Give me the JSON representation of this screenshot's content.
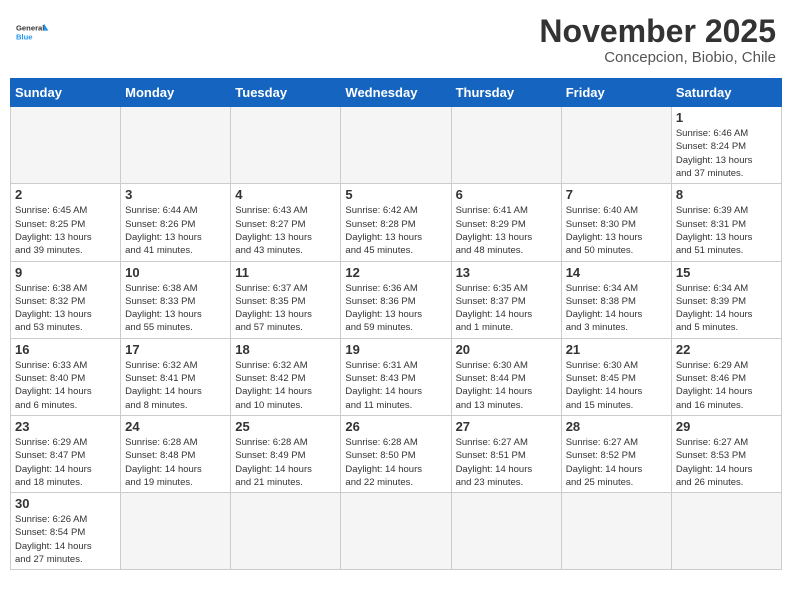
{
  "header": {
    "logo_general": "General",
    "logo_blue": "Blue",
    "month_title": "November 2025",
    "subtitle": "Concepcion, Biobio, Chile"
  },
  "days_of_week": [
    "Sunday",
    "Monday",
    "Tuesday",
    "Wednesday",
    "Thursday",
    "Friday",
    "Saturday"
  ],
  "weeks": [
    [
      {
        "day": "",
        "info": ""
      },
      {
        "day": "",
        "info": ""
      },
      {
        "day": "",
        "info": ""
      },
      {
        "day": "",
        "info": ""
      },
      {
        "day": "",
        "info": ""
      },
      {
        "day": "",
        "info": ""
      },
      {
        "day": "1",
        "info": "Sunrise: 6:46 AM\nSunset: 8:24 PM\nDaylight: 13 hours\nand 37 minutes."
      }
    ],
    [
      {
        "day": "2",
        "info": "Sunrise: 6:45 AM\nSunset: 8:25 PM\nDaylight: 13 hours\nand 39 minutes."
      },
      {
        "day": "3",
        "info": "Sunrise: 6:44 AM\nSunset: 8:26 PM\nDaylight: 13 hours\nand 41 minutes."
      },
      {
        "day": "4",
        "info": "Sunrise: 6:43 AM\nSunset: 8:27 PM\nDaylight: 13 hours\nand 43 minutes."
      },
      {
        "day": "5",
        "info": "Sunrise: 6:42 AM\nSunset: 8:28 PM\nDaylight: 13 hours\nand 45 minutes."
      },
      {
        "day": "6",
        "info": "Sunrise: 6:41 AM\nSunset: 8:29 PM\nDaylight: 13 hours\nand 48 minutes."
      },
      {
        "day": "7",
        "info": "Sunrise: 6:40 AM\nSunset: 8:30 PM\nDaylight: 13 hours\nand 50 minutes."
      },
      {
        "day": "8",
        "info": "Sunrise: 6:39 AM\nSunset: 8:31 PM\nDaylight: 13 hours\nand 51 minutes."
      }
    ],
    [
      {
        "day": "9",
        "info": "Sunrise: 6:38 AM\nSunset: 8:32 PM\nDaylight: 13 hours\nand 53 minutes."
      },
      {
        "day": "10",
        "info": "Sunrise: 6:38 AM\nSunset: 8:33 PM\nDaylight: 13 hours\nand 55 minutes."
      },
      {
        "day": "11",
        "info": "Sunrise: 6:37 AM\nSunset: 8:35 PM\nDaylight: 13 hours\nand 57 minutes."
      },
      {
        "day": "12",
        "info": "Sunrise: 6:36 AM\nSunset: 8:36 PM\nDaylight: 13 hours\nand 59 minutes."
      },
      {
        "day": "13",
        "info": "Sunrise: 6:35 AM\nSunset: 8:37 PM\nDaylight: 14 hours\nand 1 minute."
      },
      {
        "day": "14",
        "info": "Sunrise: 6:34 AM\nSunset: 8:38 PM\nDaylight: 14 hours\nand 3 minutes."
      },
      {
        "day": "15",
        "info": "Sunrise: 6:34 AM\nSunset: 8:39 PM\nDaylight: 14 hours\nand 5 minutes."
      }
    ],
    [
      {
        "day": "16",
        "info": "Sunrise: 6:33 AM\nSunset: 8:40 PM\nDaylight: 14 hours\nand 6 minutes."
      },
      {
        "day": "17",
        "info": "Sunrise: 6:32 AM\nSunset: 8:41 PM\nDaylight: 14 hours\nand 8 minutes."
      },
      {
        "day": "18",
        "info": "Sunrise: 6:32 AM\nSunset: 8:42 PM\nDaylight: 14 hours\nand 10 minutes."
      },
      {
        "day": "19",
        "info": "Sunrise: 6:31 AM\nSunset: 8:43 PM\nDaylight: 14 hours\nand 11 minutes."
      },
      {
        "day": "20",
        "info": "Sunrise: 6:30 AM\nSunset: 8:44 PM\nDaylight: 14 hours\nand 13 minutes."
      },
      {
        "day": "21",
        "info": "Sunrise: 6:30 AM\nSunset: 8:45 PM\nDaylight: 14 hours\nand 15 minutes."
      },
      {
        "day": "22",
        "info": "Sunrise: 6:29 AM\nSunset: 8:46 PM\nDaylight: 14 hours\nand 16 minutes."
      }
    ],
    [
      {
        "day": "23",
        "info": "Sunrise: 6:29 AM\nSunset: 8:47 PM\nDaylight: 14 hours\nand 18 minutes."
      },
      {
        "day": "24",
        "info": "Sunrise: 6:28 AM\nSunset: 8:48 PM\nDaylight: 14 hours\nand 19 minutes."
      },
      {
        "day": "25",
        "info": "Sunrise: 6:28 AM\nSunset: 8:49 PM\nDaylight: 14 hours\nand 21 minutes."
      },
      {
        "day": "26",
        "info": "Sunrise: 6:28 AM\nSunset: 8:50 PM\nDaylight: 14 hours\nand 22 minutes."
      },
      {
        "day": "27",
        "info": "Sunrise: 6:27 AM\nSunset: 8:51 PM\nDaylight: 14 hours\nand 23 minutes."
      },
      {
        "day": "28",
        "info": "Sunrise: 6:27 AM\nSunset: 8:52 PM\nDaylight: 14 hours\nand 25 minutes."
      },
      {
        "day": "29",
        "info": "Sunrise: 6:27 AM\nSunset: 8:53 PM\nDaylight: 14 hours\nand 26 minutes."
      }
    ],
    [
      {
        "day": "30",
        "info": "Sunrise: 6:26 AM\nSunset: 8:54 PM\nDaylight: 14 hours\nand 27 minutes."
      },
      {
        "day": "",
        "info": ""
      },
      {
        "day": "",
        "info": ""
      },
      {
        "day": "",
        "info": ""
      },
      {
        "day": "",
        "info": ""
      },
      {
        "day": "",
        "info": ""
      },
      {
        "day": "",
        "info": ""
      }
    ]
  ]
}
